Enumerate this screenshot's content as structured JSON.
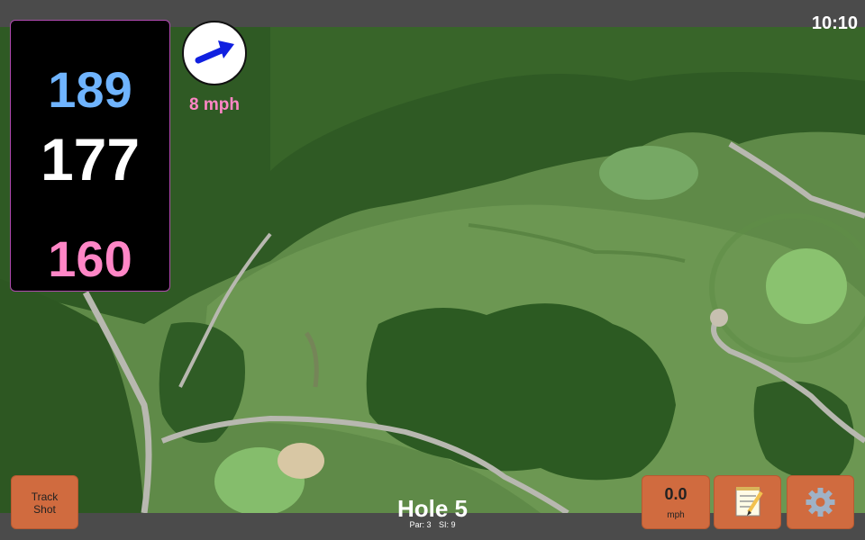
{
  "status": {
    "time": "10:10"
  },
  "distances": {
    "back": "189",
    "middle": "177",
    "front": "160"
  },
  "wind": {
    "speed": "8 mph",
    "direction_icon": "arrow-icon"
  },
  "buttons": {
    "track_shot_line1": "Track",
    "track_shot_line2": "Shot",
    "speed_value": "0.0",
    "speed_unit": "mph",
    "notes_icon": "notepad-icon",
    "settings_icon": "gear-icon"
  },
  "hole": {
    "title": "Hole 5",
    "par": "Par: 3",
    "si": "SI: 9"
  },
  "colors": {
    "back": "#6fb4ff",
    "middle": "#ffffff",
    "front": "#ff86c6",
    "button": "#d06b3f"
  }
}
